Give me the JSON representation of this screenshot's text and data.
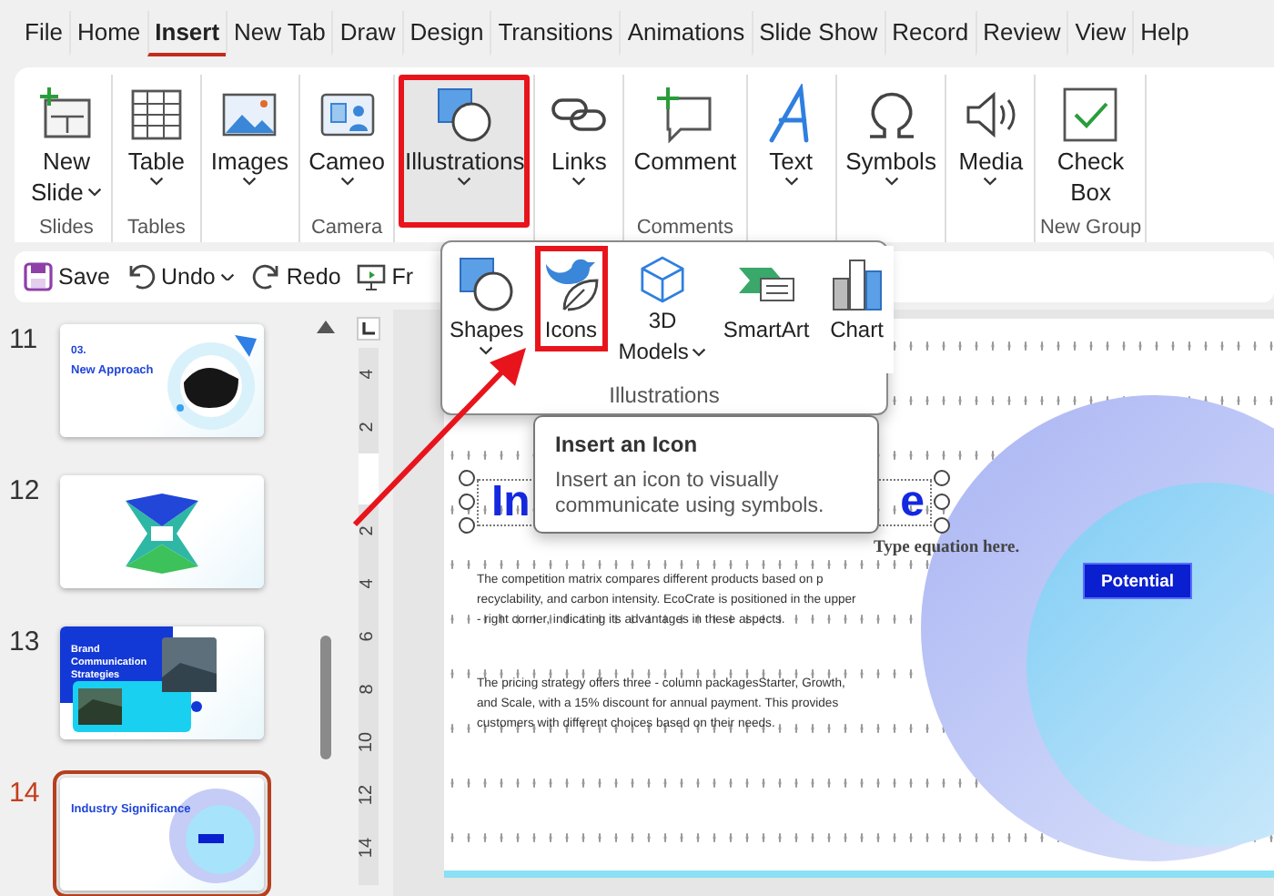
{
  "menu_tabs": [
    {
      "label": "File",
      "selected": false
    },
    {
      "label": "Home",
      "selected": false
    },
    {
      "label": "Insert",
      "selected": true
    },
    {
      "label": "New Tab",
      "selected": false
    },
    {
      "label": "Draw",
      "selected": false
    },
    {
      "label": "Design",
      "selected": false
    },
    {
      "label": "Transitions",
      "selected": false
    },
    {
      "label": "Animations",
      "selected": false
    },
    {
      "label": "Slide Show",
      "selected": false
    },
    {
      "label": "Record",
      "selected": false
    },
    {
      "label": "Review",
      "selected": false
    },
    {
      "label": "View",
      "selected": false
    },
    {
      "label": "Help",
      "selected": false
    }
  ],
  "ribbon": {
    "groups": [
      {
        "label": "Slides",
        "items": [
          {
            "kind": "slide",
            "label_lines": [
              "New",
              "Slide"
            ],
            "caret": true,
            "selected": false,
            "highlighted": false
          }
        ]
      },
      {
        "label": "Tables",
        "items": [
          {
            "kind": "table",
            "label_lines": [
              "Table"
            ],
            "caret": true,
            "selected": false,
            "highlighted": false
          }
        ]
      },
      {
        "items": [
          {
            "kind": "images",
            "label_lines": [
              "Images"
            ],
            "caret": true,
            "selected": false,
            "highlighted": false
          }
        ]
      },
      {
        "label": "Camera",
        "items": [
          {
            "kind": "cameo",
            "label_lines": [
              "Cameo"
            ],
            "caret": true,
            "selected": false,
            "highlighted": false
          }
        ]
      },
      {
        "items": [
          {
            "kind": "illustrations",
            "label_lines": [
              "Illustrations"
            ],
            "caret": true,
            "selected": true,
            "highlighted": true
          }
        ]
      },
      {
        "items": [
          {
            "kind": "links",
            "label_lines": [
              "Links"
            ],
            "caret": true,
            "selected": false,
            "highlighted": false
          }
        ]
      },
      {
        "label": "Comments",
        "items": [
          {
            "kind": "comment",
            "label_lines": [
              "Comment"
            ],
            "caret": false,
            "selected": false,
            "highlighted": false
          }
        ]
      },
      {
        "items": [
          {
            "kind": "text",
            "label_lines": [
              "Text"
            ],
            "caret": true,
            "selected": false,
            "highlighted": false
          }
        ]
      },
      {
        "items": [
          {
            "kind": "symbols",
            "label_lines": [
              "Symbols"
            ],
            "caret": true,
            "selected": false,
            "highlighted": false
          }
        ]
      },
      {
        "items": [
          {
            "kind": "media",
            "label_lines": [
              "Media"
            ],
            "caret": true,
            "selected": false,
            "highlighted": false
          }
        ]
      },
      {
        "label": "New Group",
        "items": [
          {
            "kind": "checkbox",
            "label_lines": [
              "Check",
              "Box"
            ],
            "caret": false,
            "selected": false,
            "highlighted": false
          }
        ]
      }
    ]
  },
  "quick_access": [
    {
      "kind": "save",
      "label": "Save",
      "caret": false
    },
    {
      "kind": "undo",
      "label": "Undo",
      "caret": true
    },
    {
      "kind": "redo",
      "label": "Redo",
      "caret": false
    },
    {
      "kind": "present",
      "label": "Fr",
      "caret": false
    }
  ],
  "dropdown": {
    "group_label": "Illustrations",
    "items": [
      {
        "kind": "shapes",
        "label_lines": [
          "Shapes"
        ],
        "caret": true,
        "highlighted": false
      },
      {
        "kind": "icons",
        "label_lines": [
          "Icons"
        ],
        "caret": false,
        "highlighted": true
      },
      {
        "kind": "models",
        "label_lines": [
          "3D",
          "Models"
        ],
        "caret": true,
        "highlighted": false
      },
      {
        "kind": "smartart",
        "label_lines": [
          "SmartArt"
        ],
        "caret": false,
        "highlighted": false
      },
      {
        "kind": "chart",
        "label_lines": [
          "Chart"
        ],
        "caret": false,
        "highlighted": false
      }
    ]
  },
  "tooltip": {
    "title": "Insert an Icon",
    "body": "Insert an icon to visually communicate using symbols."
  },
  "thumbnails": [
    {
      "number": "11",
      "kind": "approach",
      "selected": false,
      "texts": [
        "03.",
        "New Approach"
      ]
    },
    {
      "number": "12",
      "kind": "diagram",
      "selected": false
    },
    {
      "number": "13",
      "kind": "brand",
      "selected": false,
      "texts": [
        "Brand Communication Strategies"
      ]
    },
    {
      "number": "14",
      "kind": "industry",
      "selected": true,
      "texts": [
        "Industry Significance"
      ]
    }
  ],
  "ruler": {
    "labels": [
      "4",
      "2",
      "2",
      "4",
      "6",
      "8",
      "10",
      "12",
      "14"
    ]
  },
  "slide": {
    "title_start": "In",
    "title_end": "e",
    "paragraphs": [
      "The competition matrix compares different products based on p recyclability, and carbon intensity. EcoCrate is positioned in the upper - right corner, indicating its advantages in these aspects.",
      "The pricing strategy offers three - column packagesStarter, Growth, and Scale, with a 15% discount for annual payment. This provides customers with different choices based on their needs."
    ],
    "equation": "Type equation here.",
    "button": "Potential"
  }
}
